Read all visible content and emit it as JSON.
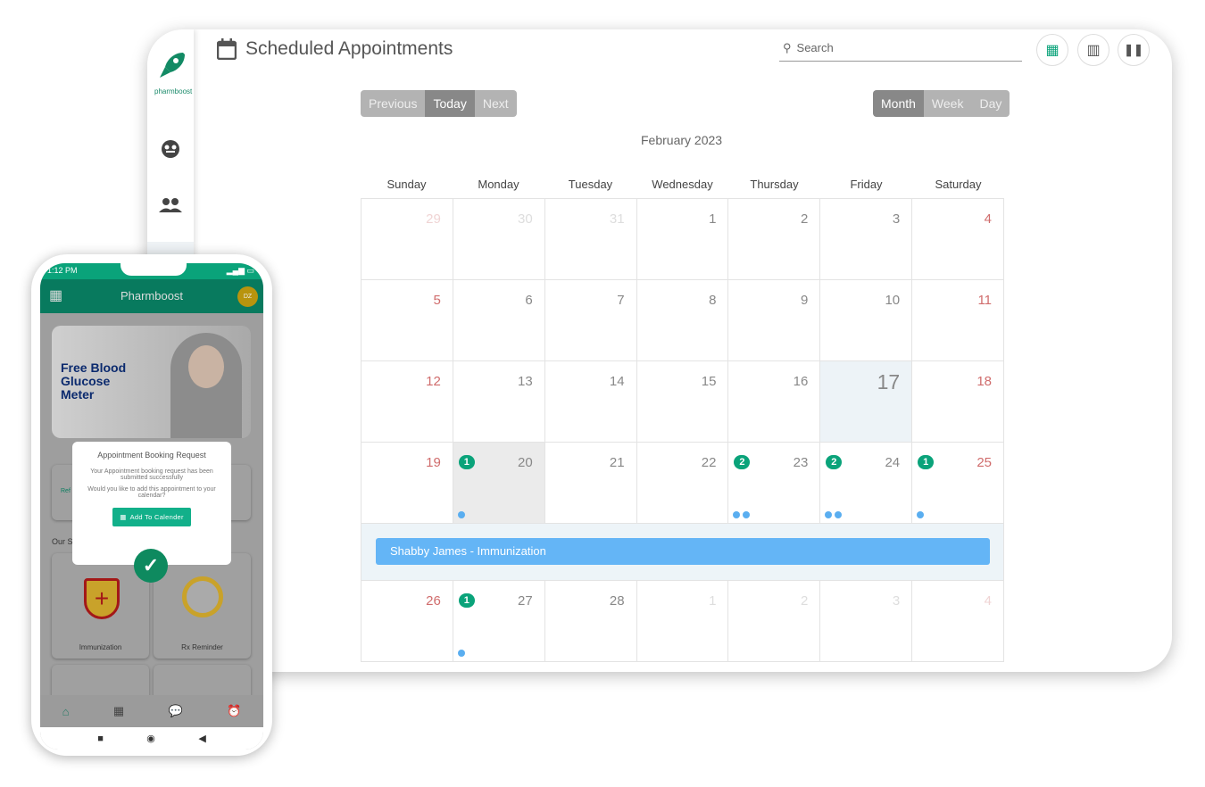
{
  "app": {
    "title": "Scheduled Appointments",
    "logo_text": "pharmboost",
    "search_placeholder": "Search"
  },
  "toolbar": {
    "previous": "Previous",
    "today": "Today",
    "next": "Next",
    "month": "Month",
    "week": "Week",
    "day": "Day"
  },
  "calendar": {
    "month_label": "February 2023",
    "weekdays": [
      "Sunday",
      "Monday",
      "Tuesday",
      "Wednesday",
      "Thursday",
      "Friday",
      "Saturday"
    ],
    "weeks": [
      [
        {
          "d": "29",
          "m": 1
        },
        {
          "d": "30",
          "m": 1
        },
        {
          "d": "31",
          "m": 1
        },
        {
          "d": "1"
        },
        {
          "d": "2"
        },
        {
          "d": "3"
        },
        {
          "d": "4"
        }
      ],
      [
        {
          "d": "5"
        },
        {
          "d": "6"
        },
        {
          "d": "7"
        },
        {
          "d": "8"
        },
        {
          "d": "9"
        },
        {
          "d": "10"
        },
        {
          "d": "11"
        }
      ],
      [
        {
          "d": "12"
        },
        {
          "d": "13"
        },
        {
          "d": "14"
        },
        {
          "d": "15"
        },
        {
          "d": "16"
        },
        {
          "d": "17",
          "today": 1
        },
        {
          "d": "18"
        }
      ],
      [
        {
          "d": "19"
        },
        {
          "d": "20",
          "b": "1",
          "dots": 1,
          "sel": 1
        },
        {
          "d": "21"
        },
        {
          "d": "22"
        },
        {
          "d": "23",
          "b": "2",
          "dots": 2
        },
        {
          "d": "24",
          "b": "2",
          "dots": 2
        },
        {
          "d": "25",
          "b": "1",
          "dots": 1
        }
      ],
      [
        {
          "d": "26"
        },
        {
          "d": "27",
          "b": "1",
          "dots": 1
        },
        {
          "d": "28"
        },
        {
          "d": "1",
          "m": 1
        },
        {
          "d": "2",
          "m": 1
        },
        {
          "d": "3",
          "m": 1
        },
        {
          "d": "4",
          "m": 1
        }
      ]
    ],
    "expanded_event": "Shabby James - Immunization"
  },
  "colors": {
    "accent": "#0aa37a",
    "event": "#64b5f6",
    "weekend": "#d06c6c"
  },
  "phone": {
    "status_time": "1:12 PM",
    "app_title": "Pharmboost",
    "avatar": "DZ",
    "banner": "Free Blood Glucose Meter",
    "section_label": "Our S",
    "partial_card": "Ref",
    "dialog": {
      "title": "Appointment Booking Request",
      "message": "Your Appointment booking request has been submitted successfully",
      "question": "Would you like to add this appointment to your calendar?",
      "button": "Add To Calender"
    },
    "services": [
      "Immunization",
      "Rx Reminder"
    ]
  }
}
